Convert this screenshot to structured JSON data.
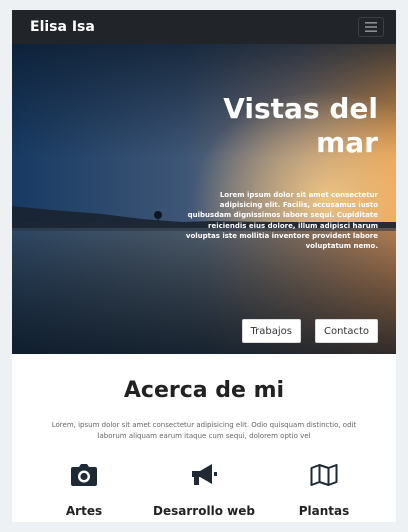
{
  "navbar": {
    "brand": "Elisa Isa",
    "menu_icon": "hamburger-icon"
  },
  "hero": {
    "title": "Vistas del mar",
    "text": "Lorem ipsum dolor sit amet consectetur adipisicing elit. Facilis, accusamus iusto quibusdam dignissimos labore sequi. Cupiditate reiciendis eius dolore, illum adipisci harum voluptas iste mollitia inventore provident labore voluptatum nemo.",
    "buttons": [
      "Trabajos",
      "Contacto"
    ]
  },
  "about": {
    "title": "Acerca de mi",
    "text": "Lorem, ipsum dolor sit amet consectetur adipisicing elit. Odio quisquam distinctio, odit laborum aliquam earum itaque cum sequi, dolorem optio vel",
    "features": [
      {
        "label": "Artes",
        "icon": "camera-icon"
      },
      {
        "label": "Desarrollo web",
        "icon": "megaphone-icon"
      },
      {
        "label": "Plantas",
        "icon": "map-icon"
      }
    ]
  },
  "colors": {
    "navbar": "#212529",
    "background": "#eef1f4"
  }
}
